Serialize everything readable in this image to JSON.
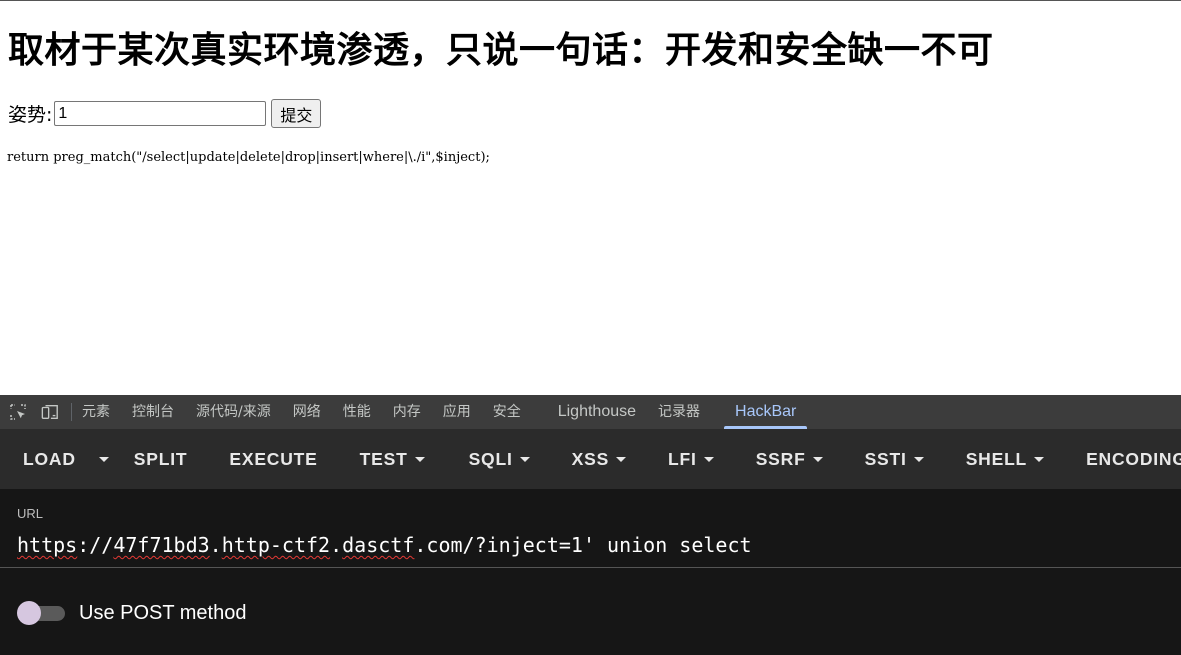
{
  "page": {
    "heading": "取材于某次真实环境渗透，只说一句话：开发和安全缺一不可",
    "form": {
      "label": "姿势:",
      "input_value": "1",
      "submit_label": "提交"
    },
    "code_line": "return preg_match(\"/select|update|delete|drop|insert|where|\\./i\",$inject);"
  },
  "devtools": {
    "icons": [
      "inspect-element-icon",
      "device-toolbar-icon"
    ],
    "tabs": [
      {
        "label": "元素"
      },
      {
        "label": "控制台"
      },
      {
        "label": "源代码/来源"
      },
      {
        "label": "网络"
      },
      {
        "label": "性能"
      },
      {
        "label": "内存"
      },
      {
        "label": "应用"
      },
      {
        "label": "安全"
      },
      {
        "label": "Lighthouse"
      },
      {
        "label": "记录器"
      },
      {
        "label": "HackBar",
        "active": true
      }
    ],
    "active_color": "#a8c7fa"
  },
  "hackbar": {
    "toolbar": {
      "load": "LOAD",
      "split": "SPLIT",
      "execute": "EXECUTE",
      "test": "TEST",
      "sqli": "SQLI",
      "xss": "XSS",
      "lfi": "LFI",
      "ssrf": "SSRF",
      "ssti": "SSTI",
      "shell": "SHELL",
      "encoding": "ENCODING"
    },
    "url_label": "URL",
    "url_parts": {
      "scheme": "https",
      "sep1": "://",
      "host_a": "47f71bd3",
      "dot1": ".",
      "host_b": "http-ctf2",
      "dot2": ".",
      "host_c": "dasctf",
      "rest": ".com/?inject=1' union select"
    },
    "post_method_label": "Use POST method",
    "post_method_enabled": false
  }
}
